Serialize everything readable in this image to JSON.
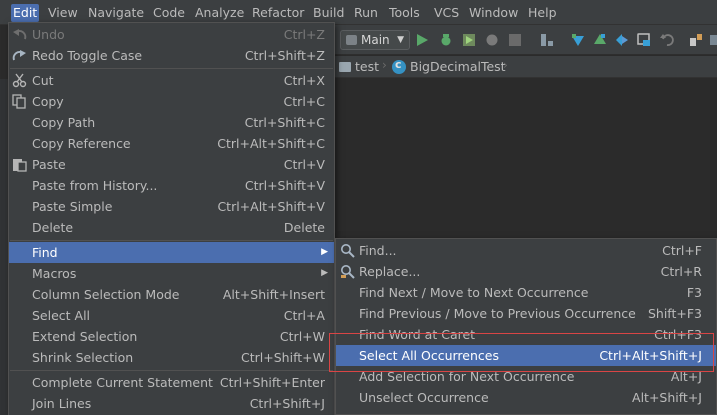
{
  "menubar": {
    "items": [
      {
        "label": "Edit",
        "active": true
      },
      {
        "label": "View"
      },
      {
        "label": "Navigate"
      },
      {
        "label": "Code"
      },
      {
        "label": "Analyze"
      },
      {
        "label": "Refactor"
      },
      {
        "label": "Build"
      },
      {
        "label": "Run"
      },
      {
        "label": "Tools"
      },
      {
        "label": "VCS"
      },
      {
        "label": "Window"
      },
      {
        "label": "Help"
      }
    ]
  },
  "toolbar": {
    "run_config": "Main",
    "icons": [
      "run-icon",
      "debug-icon",
      "coverage-icon",
      "stop-icon",
      "project-structure-icon",
      "vcs-update-icon",
      "vcs-commit-icon",
      "compare-icon",
      "history-icon",
      "revert-icon",
      "settings-icon"
    ]
  },
  "navbar": {
    "crumbs": [
      {
        "label": "test"
      },
      {
        "label": "BigDecimalTest"
      }
    ]
  },
  "edit_menu": {
    "items": [
      {
        "label": "Undo",
        "shortcut": "Ctrl+Z",
        "disabled": true,
        "icon": "undo-icon"
      },
      {
        "label": "Redo Toggle Case",
        "shortcut": "Ctrl+Shift+Z",
        "icon": "redo-icon"
      },
      {
        "label": "Cut",
        "shortcut": "Ctrl+X",
        "icon": "scissors-icon"
      },
      {
        "label": "Copy",
        "shortcut": "Ctrl+C",
        "icon": "copy-icon"
      },
      {
        "label": "Copy Path",
        "shortcut": "Ctrl+Shift+C"
      },
      {
        "label": "Copy Reference",
        "shortcut": "Ctrl+Alt+Shift+C"
      },
      {
        "label": "Paste",
        "shortcut": "Ctrl+V",
        "icon": "paste-icon"
      },
      {
        "label": "Paste from History...",
        "shortcut": "Ctrl+Shift+V"
      },
      {
        "label": "Paste Simple",
        "shortcut": "Ctrl+Alt+Shift+V"
      },
      {
        "label": "Delete",
        "shortcut": "Delete"
      },
      {
        "label": "Find",
        "shortcut": "",
        "submenu": true,
        "highlighted": true
      },
      {
        "label": "Macros",
        "shortcut": "",
        "submenu": true
      },
      {
        "label": "Column Selection Mode",
        "shortcut": "Alt+Shift+Insert"
      },
      {
        "label": "Select All",
        "shortcut": "Ctrl+A"
      },
      {
        "label": "Extend Selection",
        "shortcut": "Ctrl+W"
      },
      {
        "label": "Shrink Selection",
        "shortcut": "Ctrl+Shift+W"
      },
      {
        "label": "Complete Current Statement",
        "shortcut": "Ctrl+Shift+Enter"
      },
      {
        "label": "Join Lines",
        "shortcut": "Ctrl+Shift+J"
      }
    ]
  },
  "find_submenu": {
    "items": [
      {
        "label": "Find...",
        "shortcut": "Ctrl+F",
        "icon": "find-icon"
      },
      {
        "label": "Replace...",
        "shortcut": "Ctrl+R",
        "icon": "replace-icon"
      },
      {
        "label": "Find Next / Move to Next Occurrence",
        "shortcut": "F3"
      },
      {
        "label": "Find Previous / Move to Previous Occurrence",
        "shortcut": "Shift+F3"
      },
      {
        "label": "Find Word at Caret",
        "shortcut": "Ctrl+F3"
      },
      {
        "label": "Select All Occurrences",
        "shortcut": "Ctrl+Alt+Shift+J",
        "highlighted": true
      },
      {
        "label": "Add Selection for Next Occurrence",
        "shortcut": "Alt+J"
      },
      {
        "label": "Unselect Occurrence",
        "shortcut": "Alt+Shift+J"
      }
    ]
  },
  "colors": {
    "menu_bg": "#3c3f41",
    "selection": "#4b6eaf",
    "annotation_box": "#d94545",
    "editor_bg": "#2b2b2b"
  }
}
